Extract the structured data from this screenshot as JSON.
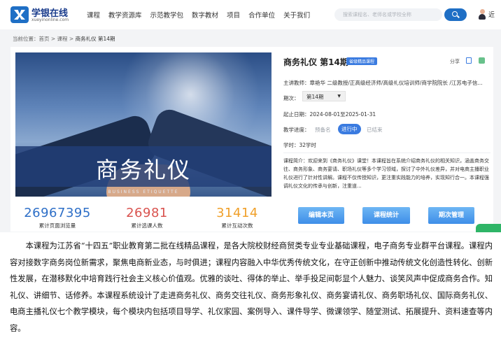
{
  "header": {
    "logo_name": "学银在线",
    "logo_url": "xueyinonline.com",
    "nav": [
      "课程",
      "教学资源库",
      "示范教学包",
      "数字教材",
      "项目",
      "合作单位",
      "关于我们"
    ],
    "search_placeholder": "搜索课程名、老师名或学校全称",
    "user_text": "近"
  },
  "breadcrumb": {
    "label": "当前位置：",
    "path": "首页 > 课程 > ",
    "current": "商务礼仪 第14期"
  },
  "cover": {
    "title": "商务礼仪",
    "subtitle": "BUSINESS ETIQUETTE"
  },
  "stats": [
    {
      "value": "26967395",
      "label": "累计页面浏览量",
      "color": "#2e6fc7"
    },
    {
      "value": "26981",
      "label": "累计选课人数",
      "color": "#d9534f"
    },
    {
      "value": "31414",
      "label": "累计互动次数",
      "color": "#f0a02a"
    }
  ],
  "course": {
    "title": "商务礼仪 第14期",
    "badge": "省级精品课程",
    "share": "分享",
    "teacher": "主讲教师：章艳华 二级教授/正高级经济师/高级礼仪培训师/商学院院长 /江苏电子信...",
    "period_label": "期次：",
    "period_value": "第14期",
    "dates": "起止日期：2024-08-01至2025-01-31",
    "progress_label": "教学进度：",
    "progress_states": [
      "预备名",
      "进行中",
      "已结束"
    ],
    "hours": "学时：32学时",
    "intro": "课程简介：欢迎来到《商务礼仪》课堂！本课程旨在系统介绍商务礼仪的相关知识，涵盖商务交往、商务形象、商务宴请、职场礼仪等多个学习领域，探讨了中外礼仪差异，并对电商主播职业礼仪进行了针对性讲解。课程不仅传授知识，更注重实践能力的培养，实现知行合一。本课程强调礼仪文化的传承与创新，注重道..."
  },
  "buttons": [
    "编辑本页",
    "课程统计",
    "期次管理"
  ],
  "paragraph": "本课程为江苏省“十四五”职业教育第二批在线精品课程，是各大院校财经商贸类专业专业基础课程，电子商务专业群平台课程。课程内容对接数字商务岗位新需求，聚焦电商新业态，与时俱进；课程内容融入中华优秀传统文化，在守正创新中推动传统文化创造性转化、创新性发展，在潜移默化中培育践行社会主义核心价值观。优雅的谈吐、得体的举止、举手投足间彰显个人魅力、谈笑风声中促成商务合作。知礼仪、讲细节、话修养。本课程系统设计了走进商务礼仪、商务交往礼仪、商务形象礼仪、商务宴请礼仪、商务职场礼仪、国际商务礼仪、电商主播礼仪七个教学模块，每个模块内包括项目导学、礼仪家园、案例导入、课件导学、微课领学、随堂测试、拓展提升、资料速查等内容。"
}
